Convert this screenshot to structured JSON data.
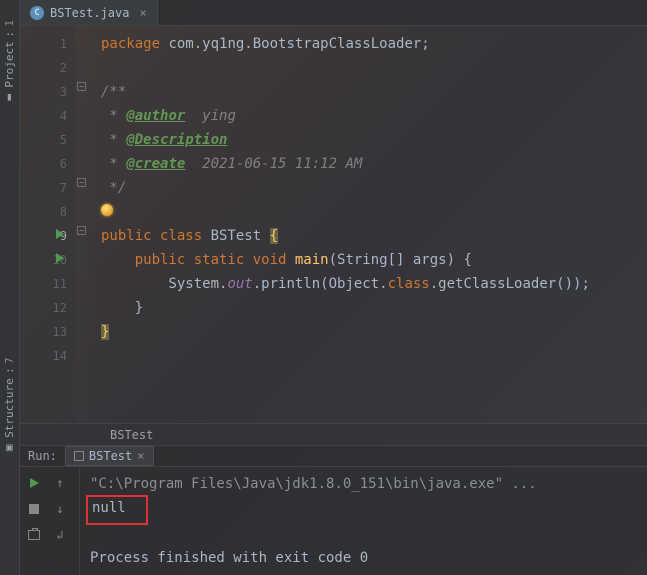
{
  "side_tabs": {
    "project": {
      "index": "1",
      "label": "Project"
    },
    "structure": {
      "index": "7",
      "label": "Structure"
    }
  },
  "file_tab": {
    "name": "BSTest.java",
    "icon_letter": "C"
  },
  "editor": {
    "lines": [
      "1",
      "2",
      "3",
      "4",
      "5",
      "6",
      "7",
      "8",
      "9",
      "10",
      "11",
      "12",
      "13",
      "14"
    ],
    "l1_kw": "package",
    "l1_pkg": " com.yq1ng.BootstrapClassLoader;",
    "l3": "/**",
    "l4_pre": " * ",
    "l4_tag": "@author",
    "l4_rest": "  ying",
    "l5_pre": " * ",
    "l5_tag": "@Description",
    "l6_pre": " * ",
    "l6_tag": "@create",
    "l6_rest": "  2021-06-15 11:12 AM",
    "l7": " */",
    "l9_kw1": "public class ",
    "l9_name": "BSTest ",
    "l9_brace": "{",
    "l10_kw": "    public static void ",
    "l10_m": "main",
    "l10_sig": "(String[] args) {",
    "l11_pre": "        System.",
    "l11_out": "out",
    "l11_mid": ".println(Object.",
    "l11_cls": "class",
    "l11_end": ".getClassLoader());",
    "l12": "    }",
    "l13": "}"
  },
  "breadcrumb": "BSTest",
  "run": {
    "label": "Run:",
    "tab_name": "BSTest",
    "cmd": "\"C:\\Program Files\\Java\\jdk1.8.0_151\\bin\\java.exe\" ...",
    "out1": "null",
    "out2": "Process finished with exit code 0"
  }
}
